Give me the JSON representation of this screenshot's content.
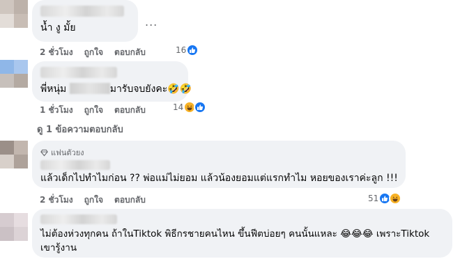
{
  "comments": [
    {
      "text": "น้ำ งู มั้ย",
      "time": "2 ชั่วโมง",
      "like_label": "ถูกใจ",
      "reply_label": "ตอบกลับ",
      "reaction_count": "16",
      "more_label": "..."
    },
    {
      "text_prefix": "พี่หนุ่ม",
      "text_suffix": "มารับจบยังคะ🤣🤣",
      "time": "1 ชั่วโมง",
      "like_label": "ถูกใจ",
      "reply_label": "ตอบกลับ",
      "reaction_count": "14"
    },
    {
      "badge": "แฟนตัวยง",
      "text": "แล้วเด็กไปทำไมก่อน ?? พ่อแม่ไม่ยอม แล้วน้องยอมแต่แรกทำไม หอยของเราค่ะลูก !!!",
      "time": "2 ชั่วโมง",
      "like_label": "ถูกใจ",
      "reply_label": "ตอบกลับ",
      "reaction_count": "51"
    },
    {
      "text_line1": "ไม่ต้องห่วงทุกคน ถ้าในTiktok พิธีกรชายคนไหน ขึ้นฟีตบ่อยๆ คนนั้นแหละ 😂😂😂 เพราะTiktok",
      "text_line2": "เขารู้งาน"
    }
  ],
  "view_replies": "ดู 1 ข้อความตอบกลับ",
  "colors": {
    "bubble": "#f0f2f5",
    "meta": "#65676b",
    "like_blue": "#1877f2",
    "haha_yellow": "#f7b125"
  }
}
